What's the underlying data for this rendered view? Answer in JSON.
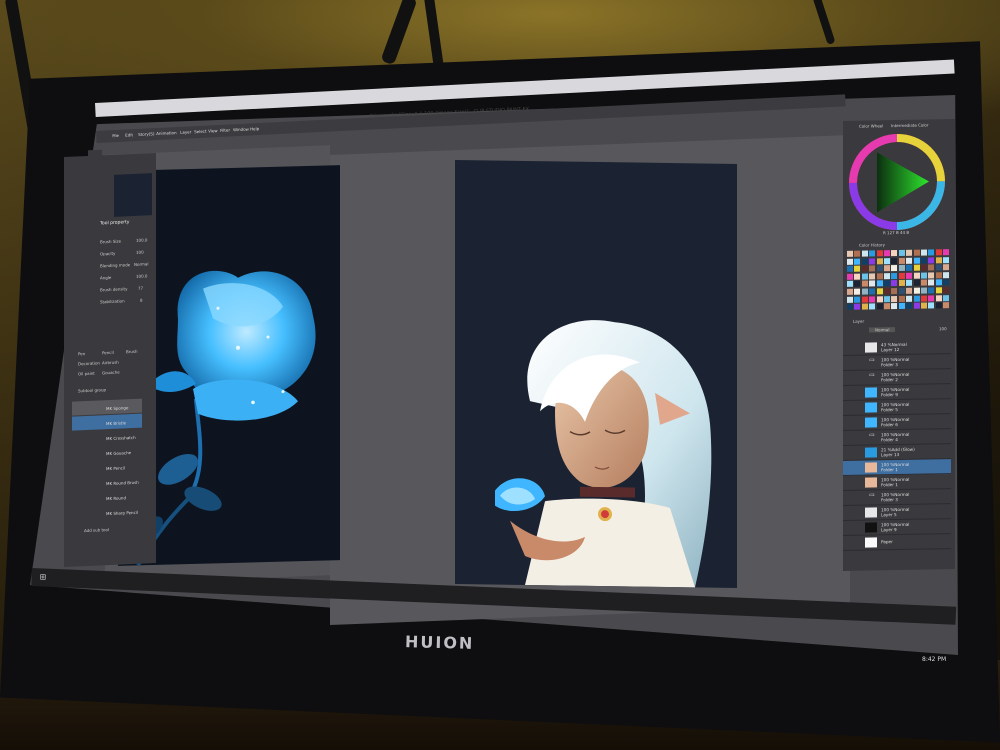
{
  "app": {
    "window_title": "Frieren.clip [Size: 1 1 100 (Image Size)] - CLIP STUDIO PAINT EX",
    "menu": [
      "File",
      "Edit",
      "Story(S)",
      "Animation",
      "Layer",
      "Select",
      "View",
      "Filter",
      "Window",
      "Help"
    ]
  },
  "tool_property": {
    "title": "Tool property",
    "rows": [
      {
        "label": "Brush Size",
        "value": "100.0"
      },
      {
        "label": "Opacity",
        "value": "100"
      },
      {
        "label": "Blending mode",
        "value": "Normal"
      },
      {
        "label": "Angle",
        "value": "100.0"
      },
      {
        "label": "Brush density",
        "value": "77"
      },
      {
        "label": "Stabilization",
        "value": "8"
      }
    ]
  },
  "subtool": {
    "tabs": [
      "Pen",
      "Pencil",
      "Brush",
      "Decoration",
      "Airbrush",
      "Oil paint",
      "Gouache"
    ],
    "category": "Subtool group",
    "brushes": [
      "MK Sponge",
      "MK Bristle",
      "MK Crosshatch",
      "MK Gouache",
      "MK Pencil",
      "MK Round Brush",
      "MK Round",
      "MK Sharp Pencil"
    ],
    "add_label": "Add sub tool"
  },
  "color_wheel": {
    "tab1": "Color Wheel",
    "tab2": "Intermediate Color",
    "readout": "R 127 B 44 B"
  },
  "color_history": {
    "title": "Color History"
  },
  "layers": {
    "title": "Layer",
    "blend_mode": "Normal",
    "opacity": "100",
    "items": [
      {
        "mode": "43 %Normal",
        "name": "Layer 12"
      },
      {
        "mode": "100 %Normal",
        "name": "Folder 3"
      },
      {
        "mode": "100 %Normal",
        "name": "Folder 2"
      },
      {
        "mode": "100 %Normal",
        "name": "Folder 9"
      },
      {
        "mode": "100 %Normal",
        "name": "Folder 5"
      },
      {
        "mode": "100 %Normal",
        "name": "Folder 6"
      },
      {
        "mode": "100 %Normal",
        "name": "Folder 4"
      },
      {
        "mode": "21 %Add (Glow)",
        "name": "Layer 13"
      },
      {
        "mode": "100 %Normal",
        "name": "Folder 1"
      },
      {
        "mode": "100 %Normal",
        "name": "Folder 1"
      },
      {
        "mode": "100 %Normal",
        "name": "Folder 3"
      },
      {
        "mode": "100 %Normal",
        "name": "Layer 5"
      },
      {
        "mode": "100 %Normal",
        "name": "Layer 9"
      },
      {
        "mode": "",
        "name": "Paper"
      }
    ]
  },
  "taskbar": {
    "clock": "8:42 PM"
  },
  "monitor": {
    "brand": "HUION"
  },
  "colors": {
    "accent": "#3a8fd9",
    "rose": "#3fb6ff",
    "bg_panel": "#3a3a3e"
  }
}
